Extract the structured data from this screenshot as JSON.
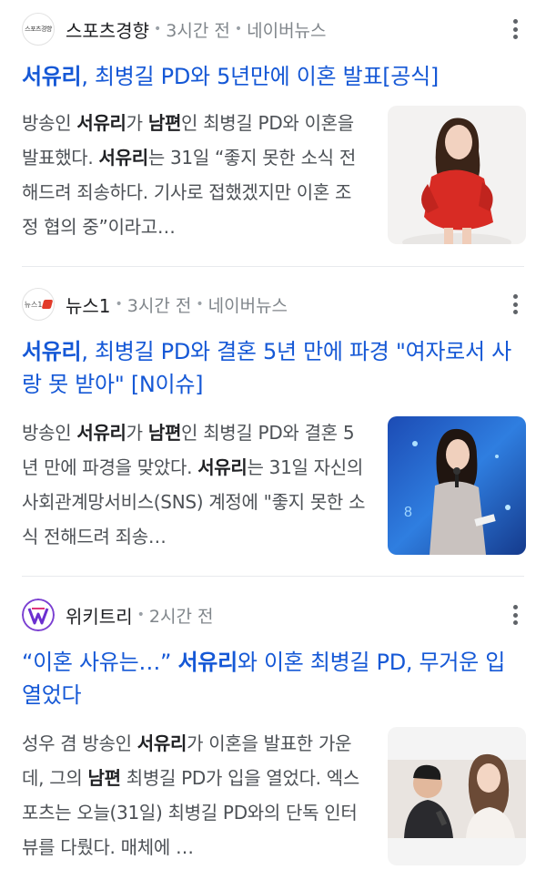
{
  "articles": [
    {
      "source": "스포츠경향",
      "logo_text": "스포츠경향",
      "time": "3시간 전",
      "platform": "네이버뉴스",
      "title_bold": "서유리",
      "title_rest": ", 최병길 PD와 5년만에 이혼 발표[공식]",
      "snippet": [
        {
          "t": "방송인 ",
          "b": false
        },
        {
          "t": "서유리",
          "b": true
        },
        {
          "t": "가 ",
          "b": false
        },
        {
          "t": "남편",
          "b": true
        },
        {
          "t": "인 최병길 PD와 이혼을 발표했다. ",
          "b": false
        },
        {
          "t": "서유리",
          "b": true
        },
        {
          "t": "는 31일 “좋지 못한 소식 전해드려 죄송하다. 기사로 접했겠지만 이혼 조정 협의 중”이라고…",
          "b": false
        }
      ],
      "thumb_desc": "woman-in-red-sweater"
    },
    {
      "source": "뉴스1",
      "logo_text": "뉴스1",
      "time": "3시간 전",
      "platform": "네이버뉴스",
      "title_bold": "서유리",
      "title_rest": ", 최병길 PD와 결혼 5년 만에 파경 \"여자로서 사랑 못 받아\" [N이슈]",
      "snippet": [
        {
          "t": "방송인 ",
          "b": false
        },
        {
          "t": "서유리",
          "b": true
        },
        {
          "t": "가 ",
          "b": false
        },
        {
          "t": "남편",
          "b": true
        },
        {
          "t": "인 최병길 PD와 결혼 5년 만에 파경을 맞았다. ",
          "b": false
        },
        {
          "t": "서유리",
          "b": true
        },
        {
          "t": "는 31일 자신의 사회관계망서비스(SNS) 계정에 \"좋지 못한 소식 전해드려 죄송…",
          "b": false
        }
      ],
      "thumb_desc": "woman-on-stage-with-microphone"
    },
    {
      "source": "위키트리",
      "time": "2시간 전",
      "title_pre": "“이혼 사유는…” ",
      "title_bold": "서유리",
      "title_rest": "와 이혼 최병길 PD, 무거운 입 열었다",
      "snippet": [
        {
          "t": "성우 겸 방송인 ",
          "b": false
        },
        {
          "t": "서유리",
          "b": true
        },
        {
          "t": "가 이혼을 발표한 가운데, 그의 ",
          "b": false
        },
        {
          "t": "남편",
          "b": true
        },
        {
          "t": " 최병길 PD가 입을 열었다. 엑스포츠는 오늘(31일) 최병길 PD와의 단독 인터뷰를 다뤘다. 매체에 …",
          "b": false
        }
      ],
      "thumb_desc": "man-and-woman-event-photo"
    }
  ],
  "colors": {
    "title": "#1558d6",
    "snippet": "#4d5156",
    "meta": "#80868b",
    "divider": "#e8eaed"
  }
}
